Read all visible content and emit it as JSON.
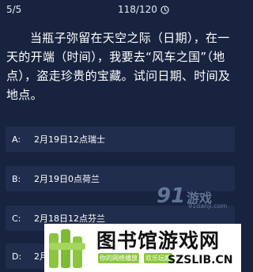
{
  "header": {
    "progress": "5/5",
    "timer": "118/120",
    "timer_icon": "clock-icon"
  },
  "question": {
    "text": "当瓶子弥留在天空之际（日期），在一天的开端（时间），我要去“风车之国”（地点），盗走珍贵的宝藏。试问日期、时间及地点。"
  },
  "options": [
    {
      "letter": "A:",
      "text": "2月19日12点瑞士"
    },
    {
      "letter": "B:",
      "text": "2月19日0点荷兰"
    },
    {
      "letter": "C:",
      "text": "2月18日12点芬兰"
    },
    {
      "letter": "D:",
      "text": "2月"
    }
  ],
  "watermark": {
    "mark": "91",
    "name": "游戏",
    "url": "91danji.com"
  },
  "banner": {
    "title": "图书馆游戏网",
    "tag1": "你的网络播放",
    "tag2": "欢乐玩趣",
    "url": "SZSLIB.CN"
  },
  "colors": {
    "background": "#17233f",
    "option_bg": "#202d4c",
    "banner_accent": "#8cc63f"
  }
}
